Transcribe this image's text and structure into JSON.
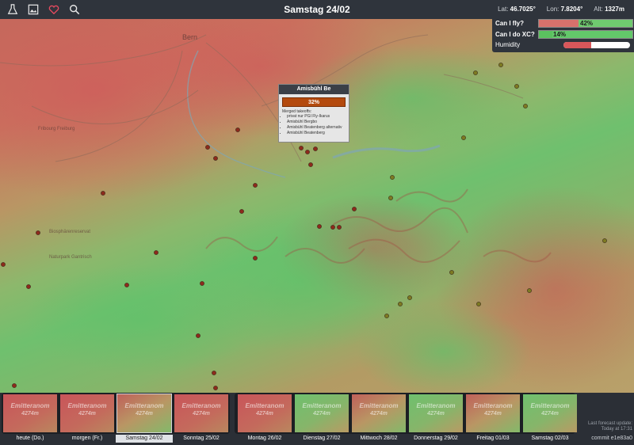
{
  "header": {
    "date": "Samstag 24/02",
    "lat_label": "Lat:",
    "lat_value": "46.7025°",
    "lon_label": "Lon:",
    "lon_value": "7.8204°",
    "alt_label": "Alt:",
    "alt_value": "1327m",
    "icons": [
      "flask-icon",
      "image-icon",
      "heart-icon",
      "search-icon"
    ],
    "heart_color": "#e84a5f"
  },
  "flypanel": {
    "can_fly_label": "Can I fly?",
    "can_fly_value": 42,
    "can_fly_text": "42%",
    "can_xc_label": "Can I do XC?",
    "can_xc_value": 14,
    "can_xc_text": "14%",
    "humidity_label": "Humidity",
    "humidity_value": 42
  },
  "popup": {
    "title": "Amisbühl Be",
    "percent": "32%",
    "merged_label": "Merged takeoffs:",
    "takeoffs": [
      "privat nur PGI Fly-Ikarus",
      "Amisbühl Bergbo",
      "Amisbühl Beatenberg alternativ",
      "Amisbühl Beatenberg"
    ]
  },
  "map_labels": {
    "bern": "Bern",
    "fribourg": "Fribourg Freiburg",
    "bund": "Biosphärenreservat",
    "naturpark": "Naturpark Gantrisch"
  },
  "days": [
    {
      "label": "heute (Do.)",
      "tone": "red"
    },
    {
      "label": "morgen (Fr.)",
      "tone": "red"
    },
    {
      "label": "Samstag 24/02",
      "tone": "mixed"
    },
    {
      "label": "Sonntag 25/02",
      "tone": "red"
    },
    {
      "label": "Montag 26/02",
      "tone": "red"
    },
    {
      "label": "Dienstag 27/02",
      "tone": "green"
    },
    {
      "label": "Mittwoch 28/02",
      "tone": "mixed"
    },
    {
      "label": "Donnerstag 29/02",
      "tone": "green"
    },
    {
      "label": "Freitag 01/03",
      "tone": "mixed"
    },
    {
      "label": "Samstag 02/03",
      "tone": "green"
    }
  ],
  "thumb_location": "Emitteranom",
  "thumb_alt": "4274m",
  "footer": {
    "last_update": "Last forecast update:",
    "today": "Today at 17:31",
    "commit": "commit e1e83a0"
  }
}
